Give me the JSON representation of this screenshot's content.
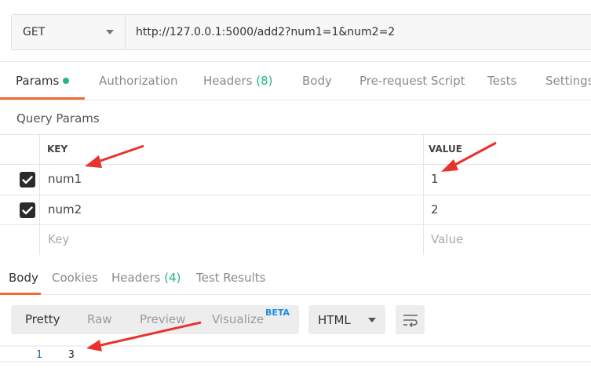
{
  "request": {
    "method": "GET",
    "url": "http://127.0.0.1:5000/add2?num1=1&num2=2"
  },
  "request_tabs": [
    {
      "label": "Params",
      "active": true,
      "indicator": "green-dot"
    },
    {
      "label": "Authorization"
    },
    {
      "label": "Headers",
      "count": "(8)"
    },
    {
      "label": "Body"
    },
    {
      "label": "Pre-request Script"
    },
    {
      "label": "Tests"
    },
    {
      "label": "Settings"
    }
  ],
  "query_params": {
    "title": "Query Params",
    "headers": {
      "key": "KEY",
      "value": "VALUE"
    },
    "rows": [
      {
        "checked": true,
        "key": "num1",
        "value": "1"
      },
      {
        "checked": true,
        "key": "num2",
        "value": "2"
      }
    ],
    "placeholders": {
      "key": "Key",
      "value": "Value"
    }
  },
  "response_tabs": [
    {
      "label": "Body",
      "active": true
    },
    {
      "label": "Cookies"
    },
    {
      "label": "Headers",
      "count": "(4)"
    },
    {
      "label": "Test Results"
    }
  ],
  "format_options": [
    "Pretty",
    "Raw",
    "Preview",
    "Visualize"
  ],
  "format_active": "Pretty",
  "visualize_badge": "BETA",
  "language": "HTML",
  "response_lines": [
    {
      "number": "1",
      "text": "3"
    }
  ],
  "colors": {
    "accent_orange": "#f26b3a",
    "green": "#26b47f",
    "annotation_red": "#e8322b",
    "beta_blue": "#1d8fe3"
  },
  "icons": [
    "chevron-down-icon",
    "check-icon",
    "wrap-lines-icon",
    "red-arrow-annotation"
  ]
}
